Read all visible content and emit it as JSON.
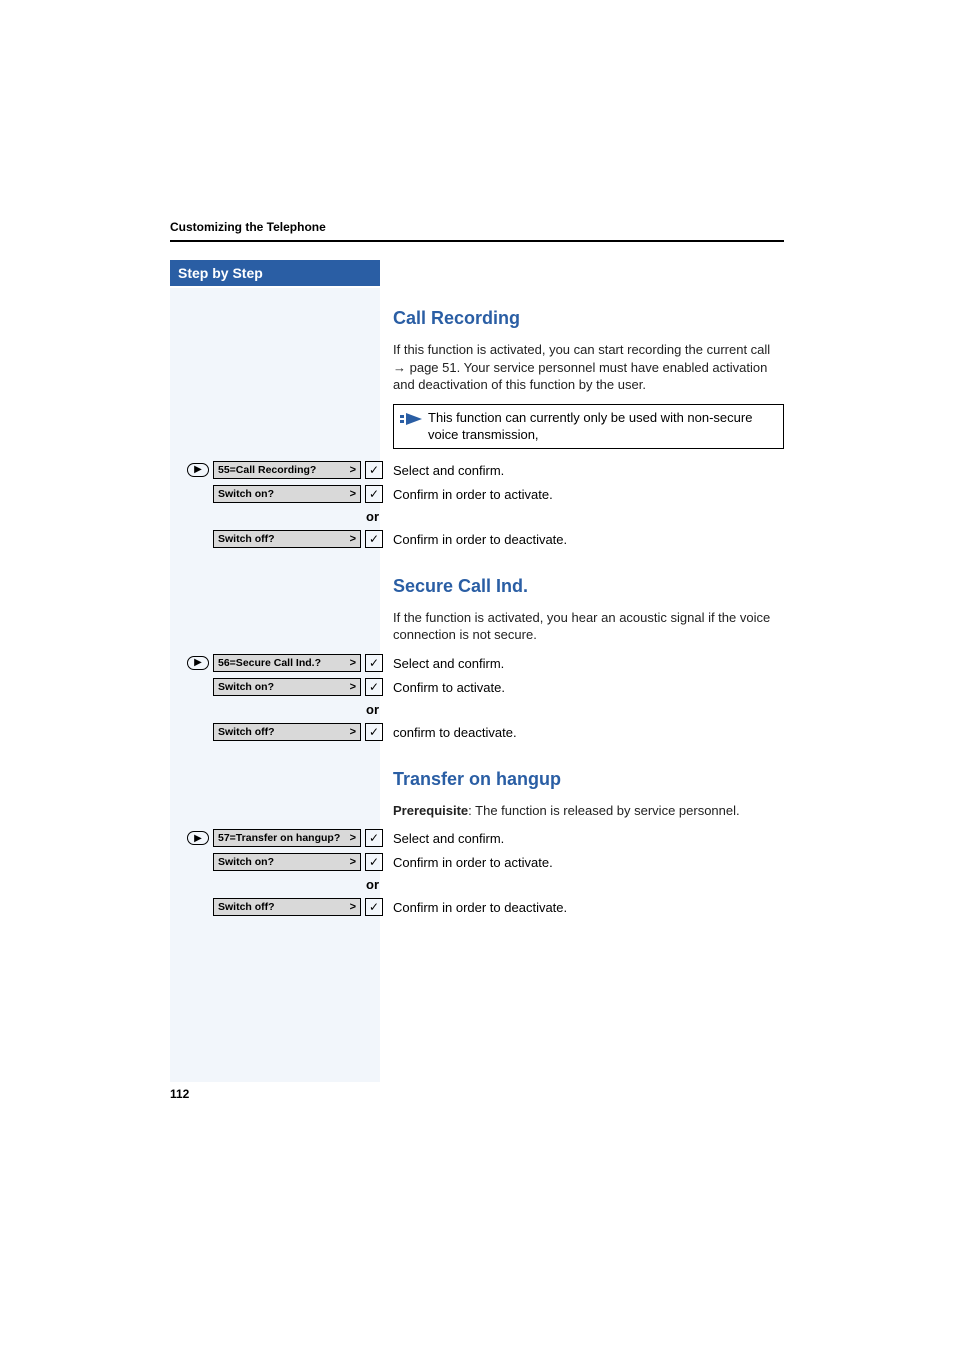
{
  "header": {
    "title": "Customizing the Telephone"
  },
  "sidebar": {
    "title": " Step by Step"
  },
  "page_number": "112",
  "or_label": "or",
  "sections": {
    "call_recording": {
      "heading": "Call Recording",
      "body_pre": "If this function is activated, you can start recording the current call ",
      "body_arrow": "→",
      "body_post": " page 51. Your service personnel must have enabled activation and deactivation of this function by the user.",
      "note": "This function can currently only be used with non-secure voice transmission,",
      "menu_item": "55=Call Recording?",
      "select_text": "Select and confirm.",
      "switch_on": "Switch on?",
      "switch_on_text": "Confirm in order to activate.",
      "switch_off": "Switch off?",
      "switch_off_text": "Confirm in order to deactivate."
    },
    "secure_call": {
      "heading": "Secure Call Ind.",
      "body": "If the function is activated, you hear an acoustic signal if the voice connection is not secure.",
      "menu_item": "56=Secure Call Ind.?",
      "select_text": "Select and confirm.",
      "switch_on": "Switch on?",
      "switch_on_text": "Confirm to activate.",
      "switch_off": "Switch off?",
      "switch_off_text": "confirm to deactivate."
    },
    "transfer": {
      "heading": "Transfer on hangup",
      "prereq_label": "Prerequisite",
      "body": ": The function is released by service personnel.",
      "menu_item": "57=Transfer on hangup?",
      "select_text": "Select and confirm.",
      "switch_on": "Switch on?",
      "switch_on_text": "Confirm in order to activate.",
      "switch_off": "Switch off?",
      "switch_off_text": "Confirm in order to deactivate."
    }
  }
}
